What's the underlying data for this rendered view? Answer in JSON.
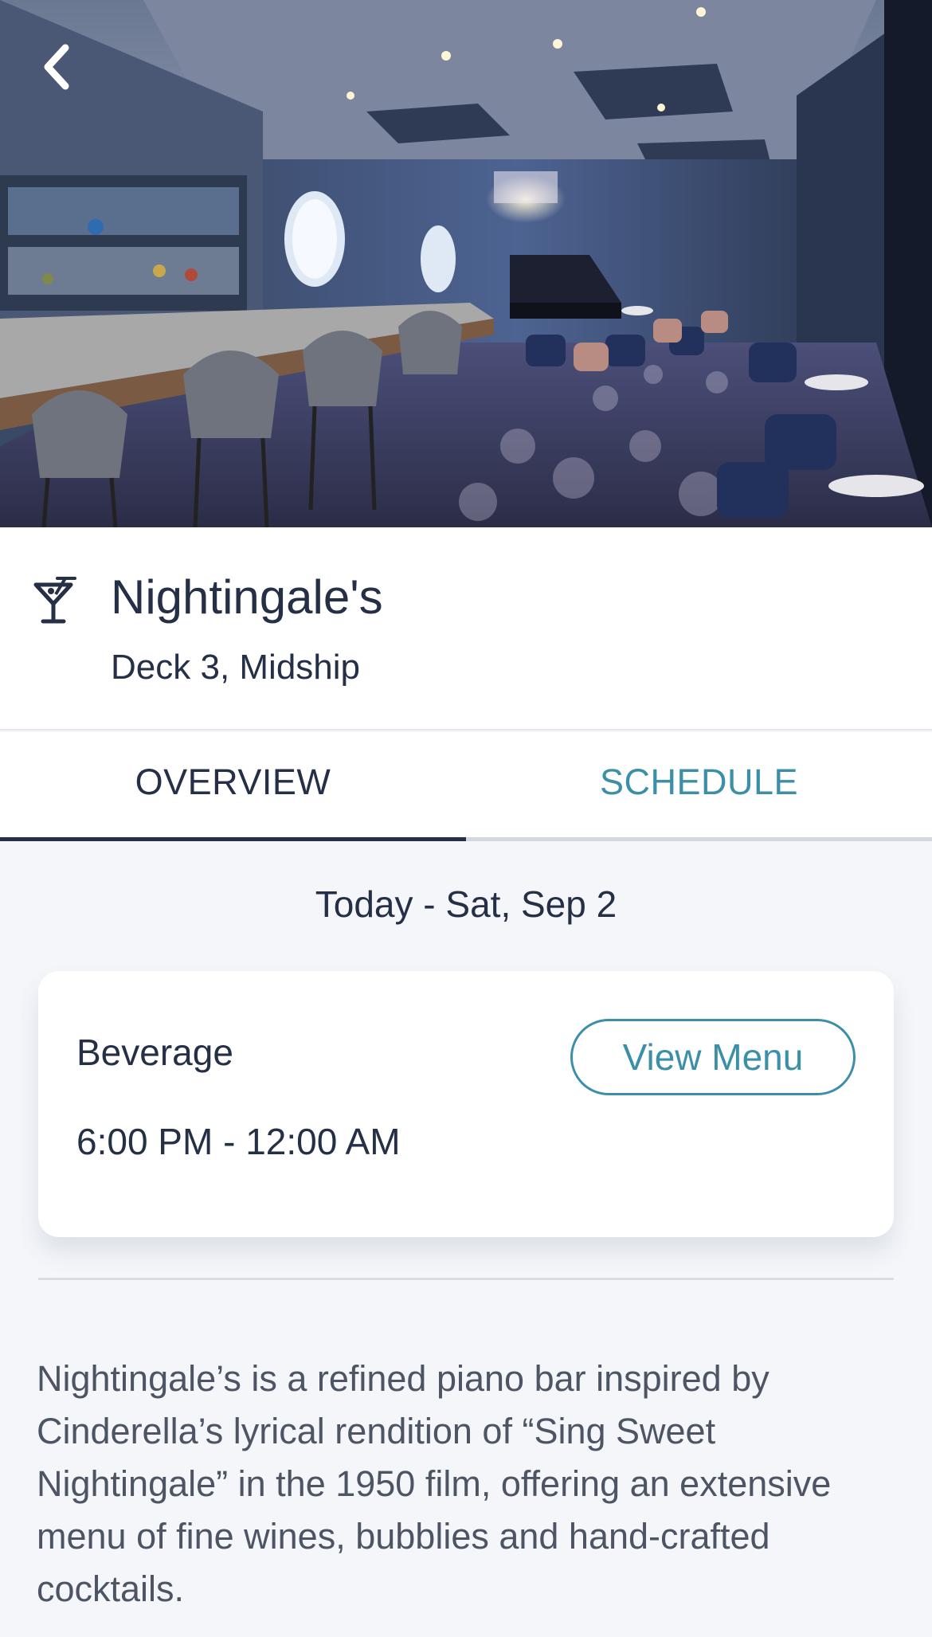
{
  "venue": {
    "name": "Nightingale's",
    "location": "Deck 3, Midship",
    "icon": "cocktail-icon"
  },
  "tabs": [
    {
      "label": "OVERVIEW",
      "active": true
    },
    {
      "label": "SCHEDULE",
      "active": false
    }
  ],
  "schedule": {
    "date_label": "Today - Sat, Sep 2",
    "entries": [
      {
        "type": "Beverage",
        "hours": "6:00 PM - 12:00 AM",
        "action_label": "View Menu"
      }
    ]
  },
  "description": "Nightingale’s is a refined piano bar inspired by Cinderella’s lyrical rendition of “Sing Sweet Nightingale” in the 1950 film, offering an extensive menu of fine wines, bubblies and hand-crafted cocktails.",
  "colors": {
    "primary_text": "#253047",
    "accent": "#3b8fa8",
    "background": "#f4f6fa"
  }
}
